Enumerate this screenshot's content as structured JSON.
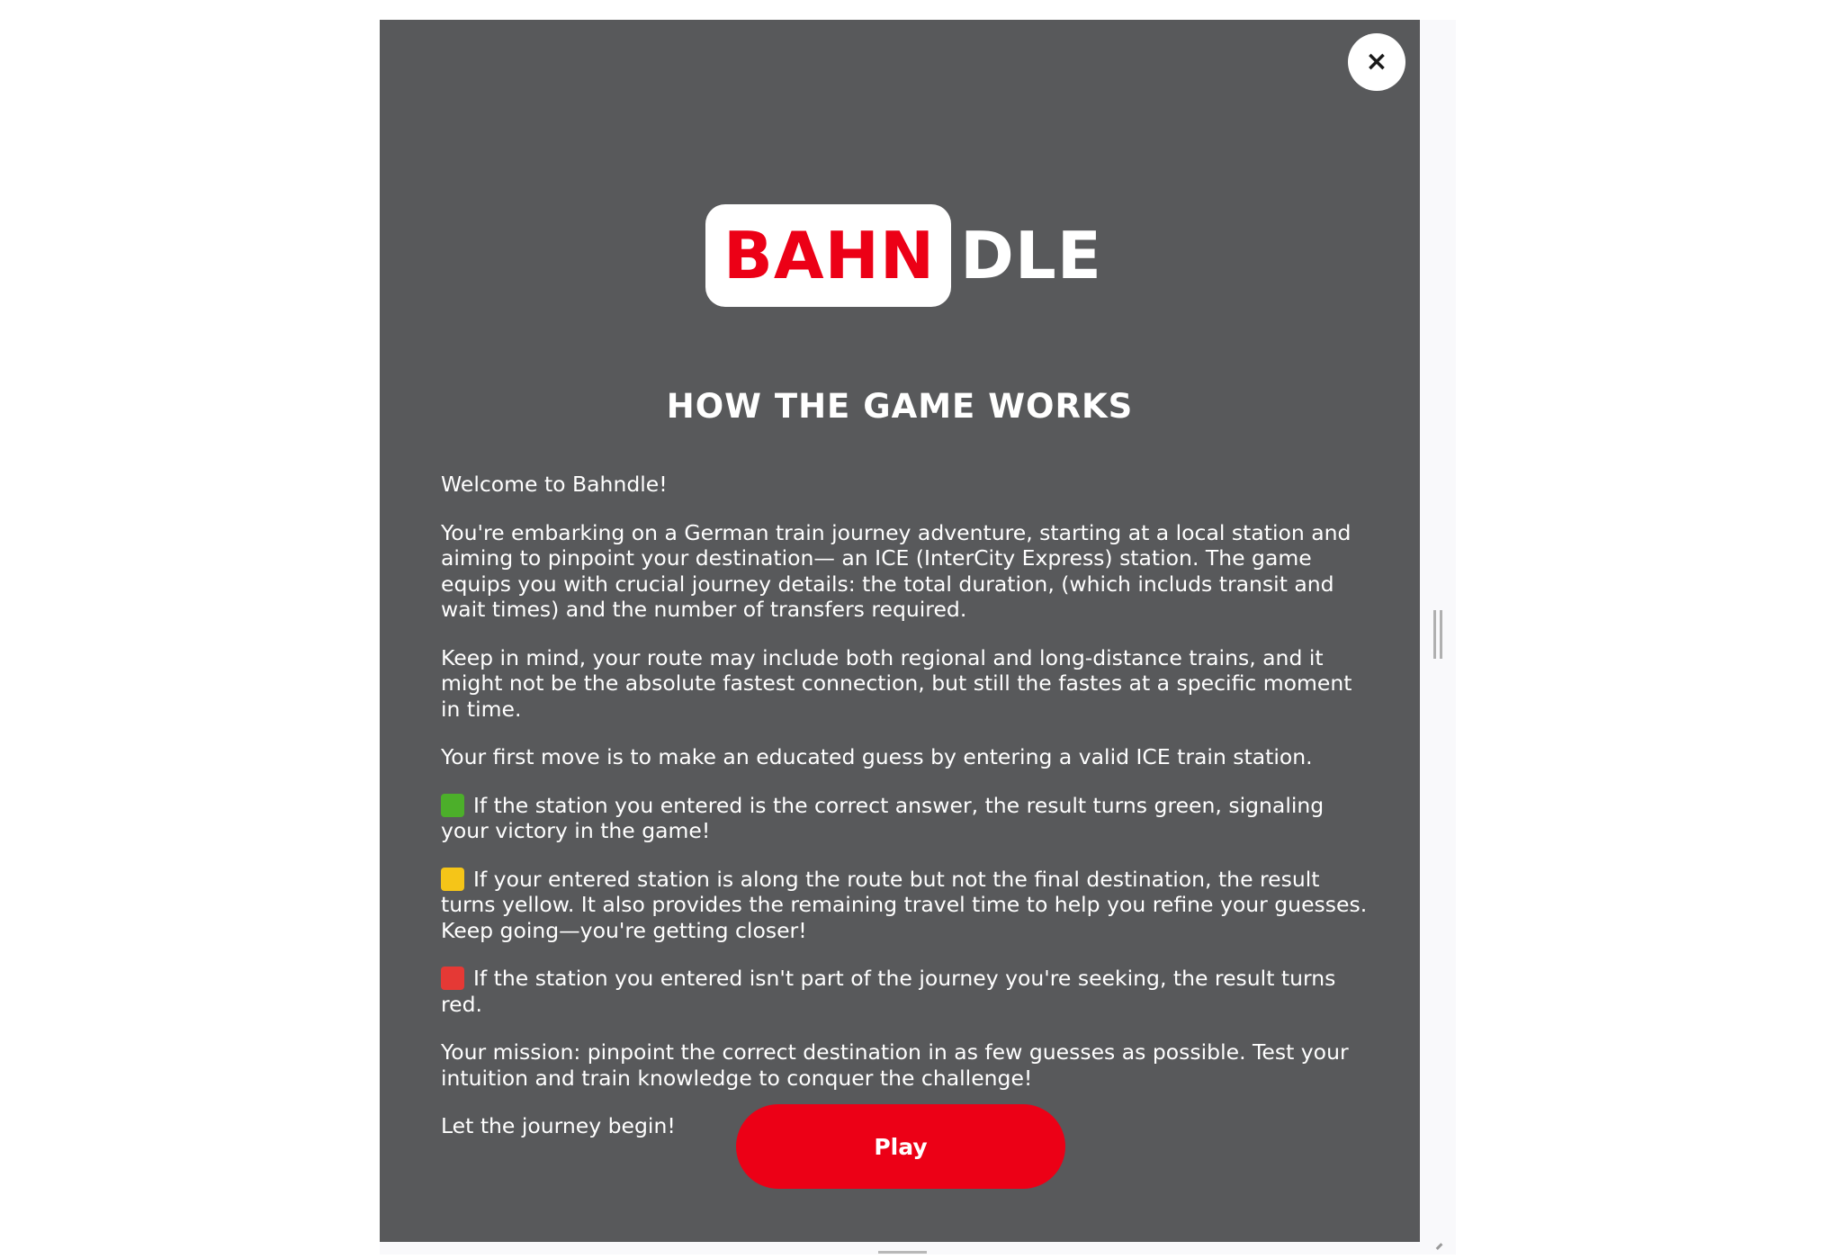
{
  "logo": {
    "part_red": "BAHN",
    "part_white": "DLE"
  },
  "modal": {
    "heading": "HOW THE GAME WORKS",
    "close_symbol": "×",
    "paragraphs": [
      "Welcome to Bahndle!",
      "You're embarking on a German train journey adventure, starting at a local station and aiming to pinpoint your destination— an ICE (InterCity Express) station. The game equips you with crucial journey details: the total duration, (which includs transit and wait times) and the number of transfers required.",
      "Keep in mind, your route may include both regional and long-distance trains, and it might not be the absolute fastest connection, but still the fastes at a specific moment in time.",
      "Your first move is to make an educated guess by entering a valid ICE train station.",
      "If the station you entered is the correct answer, the result turns green, signaling your victory in the game!",
      "If your entered station is along the route but not the final destination, the result turns yellow. It also provides the remaining travel time to help you refine your guesses. Keep going—you're getting closer!",
      "If the station you entered isn't part of the journey you're seeking, the result turns red.",
      "Your mission: pinpoint the correct destination in as few guesses as possible. Test your intuition and train knowledge to conquer the challenge!",
      "Let the journey begin!"
    ],
    "play_label": "Play"
  },
  "icons": {
    "close": "close-icon",
    "green": "green-square-icon",
    "yellow": "yellow-square-icon",
    "red": "red-square-icon"
  },
  "colors": {
    "modal_bg": "#58595b",
    "brand_red": "#ec0016",
    "green": "#4caf2a",
    "yellow": "#f5c518",
    "red": "#e53935",
    "text": "#ffffff"
  }
}
